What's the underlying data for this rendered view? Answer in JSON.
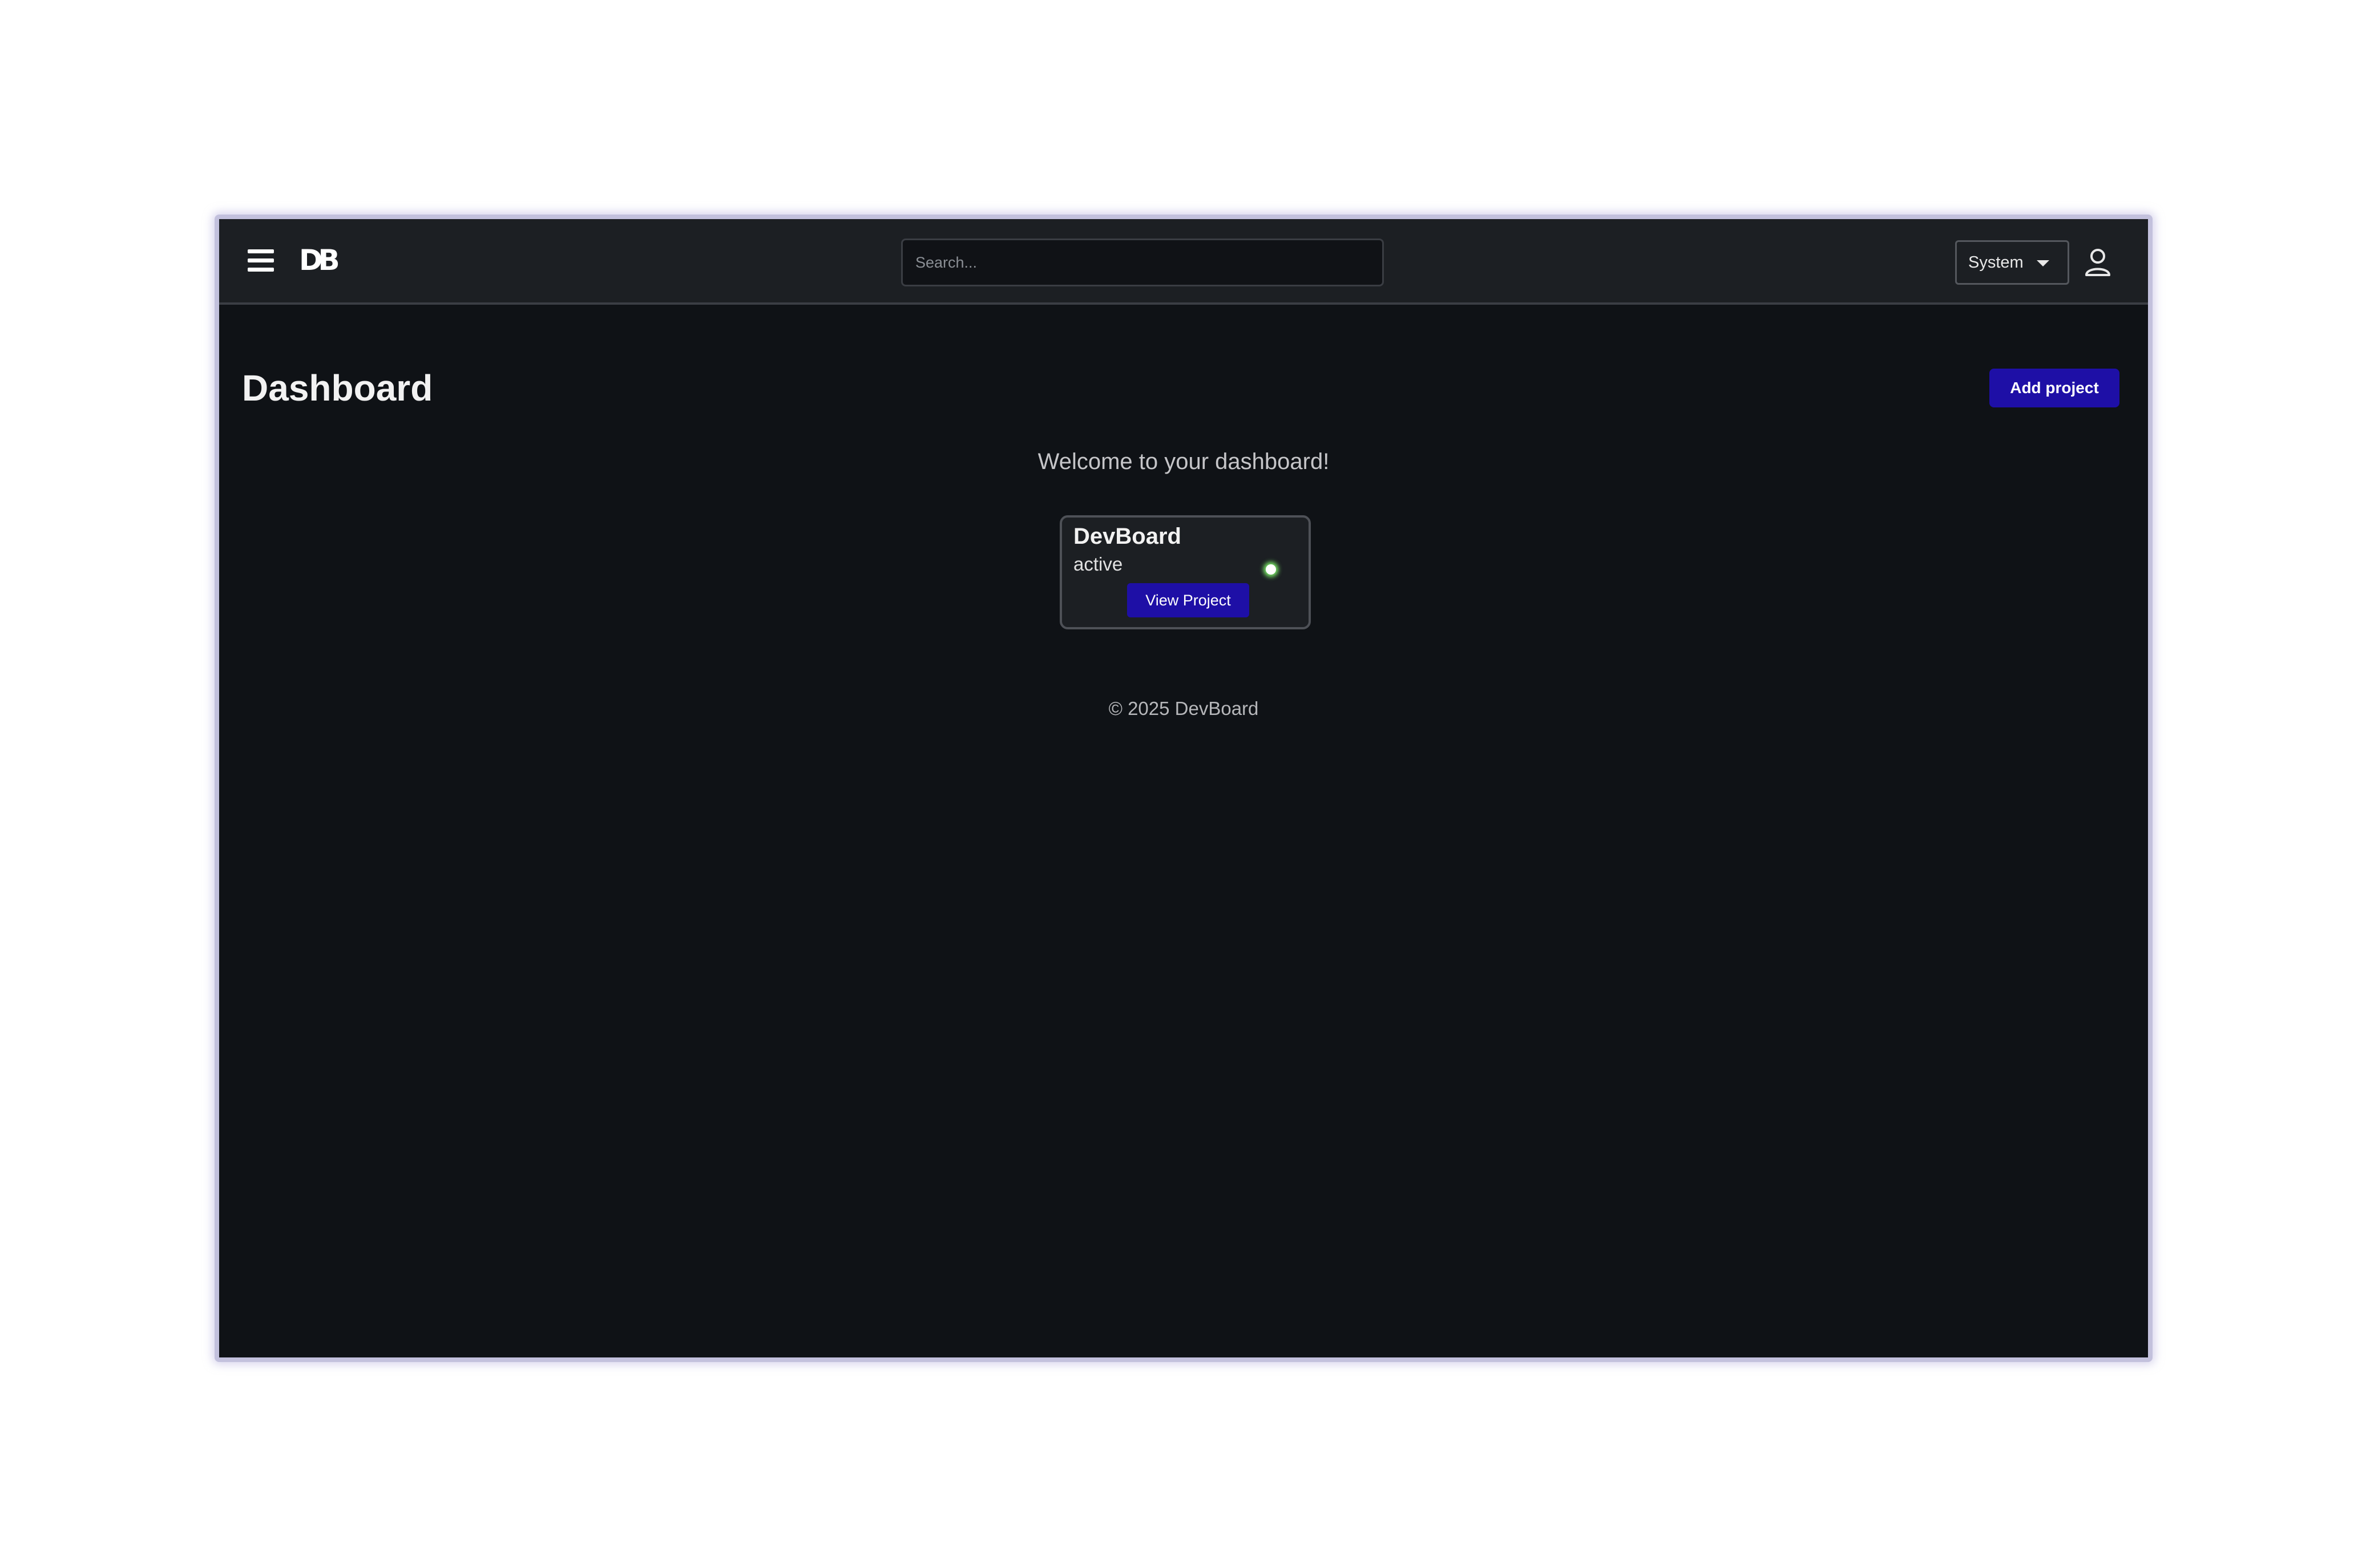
{
  "header": {
    "logo_text": "DB",
    "search_placeholder": "Search...",
    "theme_select_value": "System"
  },
  "main": {
    "title": "Dashboard",
    "add_project_label": "Add project",
    "welcome_text": "Welcome to your dashboard!",
    "project_card": {
      "name": "DevBoard",
      "status": "active",
      "status_color": "#7df06a",
      "view_label": "View Project"
    }
  },
  "footer": {
    "text": "© 2025 DevBoard"
  },
  "colors": {
    "accent": "#1e0fa6",
    "background": "#0f1216",
    "topbar": "#1c1f23"
  },
  "icons": {
    "menu": "hamburger-menu-icon",
    "user": "user-icon",
    "caret": "chevron-down-icon"
  }
}
